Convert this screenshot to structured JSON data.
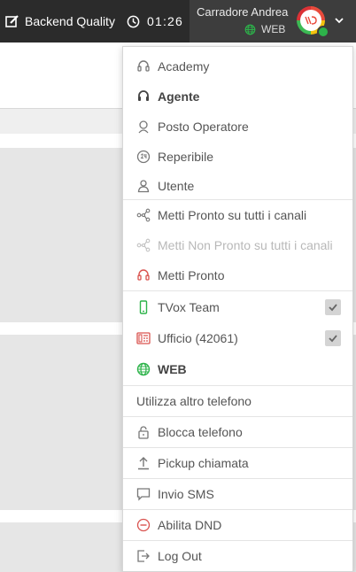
{
  "topbar": {
    "project_label": "Backend Quality",
    "timer": "01:26",
    "user_name": "Carradore Andrea",
    "channel_label": "WEB",
    "avatar_text": "TVox"
  },
  "menu": {
    "items": [
      {
        "label": "Academy",
        "icon": "headset-icon"
      },
      {
        "label": "Agente",
        "icon": "headset-bold-icon"
      },
      {
        "label": "Posto Operatore",
        "icon": "operator-icon"
      },
      {
        "label": "Reperibile",
        "icon": "clock-24-icon"
      },
      {
        "label": "Utente",
        "icon": "user-icon"
      },
      {
        "label": "Metti Pronto su tutti i canali",
        "icon": "share-nodes-icon"
      },
      {
        "label": "Metti Non Pronto su tutti i canali",
        "icon": "share-nodes-icon"
      },
      {
        "label": "Metti Pronto",
        "icon": "headset-red-icon"
      },
      {
        "label": "TVox Team",
        "icon": "mobile-icon"
      },
      {
        "label": "Ufficio (42061)",
        "icon": "desk-phone-icon"
      },
      {
        "label": "WEB",
        "icon": "globe-icon"
      },
      {
        "label": "Utilizza altro telefono"
      },
      {
        "label": "Blocca telefono",
        "icon": "lock-icon"
      },
      {
        "label": "Pickup chiamata",
        "icon": "upload-icon"
      },
      {
        "label": "Invio SMS",
        "icon": "chat-icon"
      },
      {
        "label": "Abilita DND",
        "icon": "dnd-icon"
      },
      {
        "label": "Log Out",
        "icon": "logout-icon"
      }
    ]
  },
  "colors": {
    "topbar": "#2b2b2b",
    "user_panel": "#3d3d3d",
    "accent_green": "#2db34a",
    "accent_red": "#d9534f"
  }
}
